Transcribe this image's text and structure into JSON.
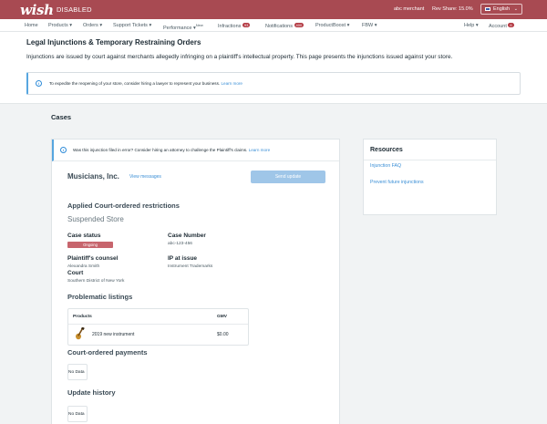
{
  "topbar": {
    "logo": "wish",
    "disabled_tag": "DISABLED",
    "merchant": "abc merchant",
    "rev_share": "Rev Share: 15.0%",
    "language": "English"
  },
  "nav": {
    "items": [
      {
        "label": "Home"
      },
      {
        "label": "Products",
        "caret": "▾"
      },
      {
        "label": "Orders",
        "caret": "▾"
      },
      {
        "label": "Support Tickets",
        "caret": "▾"
      },
      {
        "label": "Performance",
        "caret": "▾",
        "sup": "New"
      },
      {
        "label": "Infractions",
        "badge": "93"
      },
      {
        "label": "Notifications",
        "badge": "400"
      },
      {
        "label": "ProductBoost",
        "caret": "▾"
      },
      {
        "label": "FBW",
        "caret": "▾"
      },
      {
        "label": "Help",
        "caret": "▾"
      },
      {
        "label": "Account",
        "badge": "6"
      }
    ]
  },
  "header": {
    "title": "Legal Injunctions & Temporary Restraining Orders",
    "description": "Injunctions are issued by court against merchants allegedly infringing on a plaintiff's intellectual property. This page presents the injunctions issued against your store.",
    "tip_text": "To expedite the reopening of your store, consider hiring a lawyer to represent your business.",
    "tip_link": "Learn more"
  },
  "cases_title": "Cases",
  "case": {
    "tip_text": "Was this injunction filed in error? Consider hiring an attorney to challenge the Plaintiff's claims.",
    "tip_link": "Learn more",
    "merchant_name": "Musicians, Inc.",
    "view_messages": "View messages",
    "send_update": "Send update",
    "restrictions_heading": "Applied Court-ordered restrictions",
    "restriction": "Suspended Store",
    "case_status_label": "Case status",
    "case_status_value": "Ongoing",
    "case_number_label": "Case Number",
    "case_number_value": "abc-123-456",
    "counsel_label": "Plaintiff's counsel",
    "counsel_value": "Alexandra Smith",
    "ip_label": "IP at issue",
    "ip_value": "Instrument Trademarks",
    "court_label": "Court",
    "court_value": "Southern District of New York",
    "listings_heading": "Problematic listings",
    "listings_table": {
      "col_products": "Products",
      "col_gmv": "GMV",
      "rows": [
        {
          "product": "2019 new instrument",
          "gmv": "$0.00"
        }
      ]
    },
    "payments_heading": "Court-ordered payments",
    "payments_empty": "No Data",
    "history_heading": "Update history",
    "history_empty": "No Data"
  },
  "resources": {
    "title": "Resources",
    "links": [
      "Injunction FAQ",
      "Prevent future injunctions"
    ]
  },
  "colors": {
    "brand": "#a84a52",
    "link": "#3b8fd6",
    "status_ongoing": "#c7656d",
    "button_disabled": "#9fc6e8"
  }
}
